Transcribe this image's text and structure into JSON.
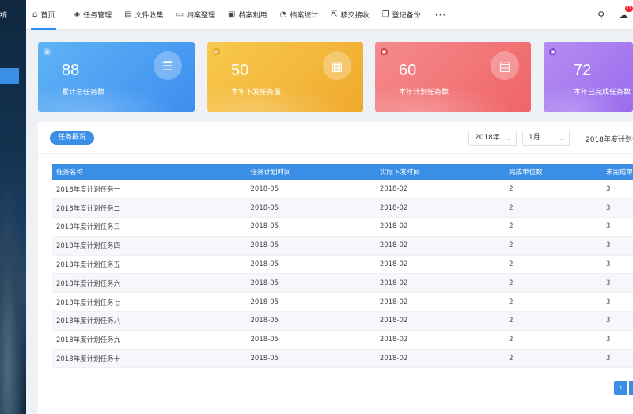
{
  "sidebar": {
    "brand": "统"
  },
  "nav": {
    "items": [
      {
        "label": "首页",
        "icon": "⌂"
      },
      {
        "label": "任务管理",
        "icon": "◈"
      },
      {
        "label": "文件收集",
        "icon": "▤"
      },
      {
        "label": "档案整理",
        "icon": "▭"
      },
      {
        "label": "档案利用",
        "icon": "▣"
      },
      {
        "label": "档案统计",
        "icon": "◔"
      },
      {
        "label": "移交接收",
        "icon": "⇱"
      },
      {
        "label": "登记备份",
        "icon": "❐"
      }
    ],
    "more": "···",
    "search_icon": "⚲",
    "message_icon": "☁",
    "badge": "12"
  },
  "cards": [
    {
      "value": "88",
      "label": "累计总任务数",
      "icon": "☰",
      "mini": "⌂"
    },
    {
      "value": "50",
      "label": "本年下发任务量",
      "icon": "▦",
      "mini": "▤"
    },
    {
      "value": "60",
      "label": "本年计划任务数",
      "icon": "▤",
      "mini": "▣"
    },
    {
      "value": "72",
      "label": "本年已完成任务数",
      "icon": "✓",
      "mini": "▣"
    }
  ],
  "panel": {
    "tab": "任务概况",
    "year": "2018年",
    "month": "1月",
    "title": "2018年度计划任"
  },
  "table": {
    "headers": [
      "任务名称",
      "任务计划时间",
      "实际下发时间",
      "完成单位数",
      "未完成单"
    ],
    "rows": [
      [
        "2018年度计划任务一",
        "2018-05",
        "2018-02",
        "2",
        "3"
      ],
      [
        "2018年度计划任务二",
        "2018-05",
        "2018-02",
        "2",
        "3"
      ],
      [
        "2018年度计划任务三",
        "2018-05",
        "2018-02",
        "2",
        "3"
      ],
      [
        "2018年度计划任务四",
        "2018-05",
        "2018-02",
        "2",
        "3"
      ],
      [
        "2018年度计划任务五",
        "2018-05",
        "2018-02",
        "2",
        "3"
      ],
      [
        "2018年度计划任务六",
        "2018-05",
        "2018-02",
        "2",
        "3"
      ],
      [
        "2018年度计划任务七",
        "2018-05",
        "2018-02",
        "2",
        "3"
      ],
      [
        "2018年度计划任务八",
        "2018-05",
        "2018-02",
        "2",
        "3"
      ],
      [
        "2018年度计划任务九",
        "2018-05",
        "2018-02",
        "2",
        "3"
      ],
      [
        "2018年度计划任务十",
        "2018-05",
        "2018-02",
        "2",
        "3"
      ]
    ]
  },
  "pager": {
    "prev": "‹"
  }
}
